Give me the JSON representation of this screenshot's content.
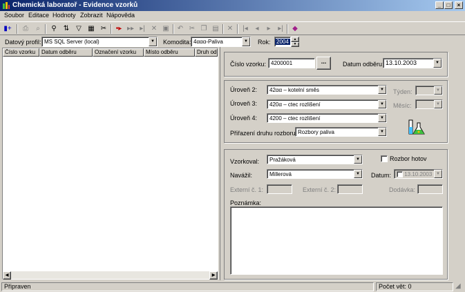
{
  "window": {
    "title": "Chemická laboratoř - Evidence vzorků",
    "minimize": "_",
    "maximize": "□",
    "close": "×"
  },
  "menu": [
    "Soubor",
    "Editace",
    "Hodnoty",
    "Zobrazit",
    "Nápověda"
  ],
  "filters": {
    "profile_label": "Datový profil:",
    "profile_value": "MS SQL Server (local)",
    "commodity_label": "Komodita:",
    "commodity_value": "4ααα-Paliva",
    "year_label": "Rok:",
    "year_value": "2004"
  },
  "grid": {
    "columns": [
      "Číslo vzorku",
      "Datum odběru",
      "Označení vzorku",
      "Místo odběru",
      "Druh od"
    ]
  },
  "sample": {
    "number_label": "Číslo vzorku:",
    "number_value": "4200001",
    "browse": "...",
    "date_label": "Datum odběru:",
    "date_value": "13.10.2003"
  },
  "levels": {
    "l2_label": "Úroveň 2:",
    "l2_value": "42αα – kotelní směs",
    "l3_label": "Úroveň 3:",
    "l3_value": "420α – ctec rozlišení",
    "l4_label": "Úroveň 4:",
    "l4_value": "4200 – ctec rozlišení",
    "analysis_label": "Přiřazení druhu rozboru:",
    "analysis_value": "Rozbory paliva",
    "week_label": "Týden:",
    "month_label": "Měsíc:"
  },
  "details": {
    "sampled_label": "Vzorkoval:",
    "sampled_value": "Pražáková",
    "done_label": "Rozbor hotov",
    "weighed_label": "Navážil:",
    "weighed_value": "Millerová",
    "date_label": "Datum:",
    "date_value": "13.10.2003",
    "ext1_label": "Externí č. 1:",
    "ext2_label": "Externí č. 2:",
    "delivery_label": "Dodávka:",
    "note_label": "Poznámka:"
  },
  "status": {
    "left": "Připraven",
    "right": "Počet vět: 0"
  }
}
